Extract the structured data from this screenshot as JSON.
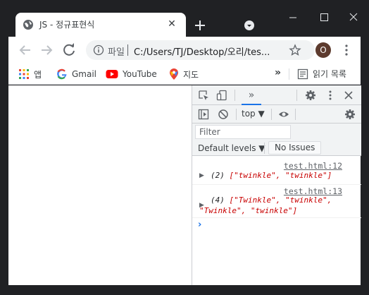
{
  "tab": {
    "title": "JS - 정규표현식",
    "close_glyph": "✕"
  },
  "toolbar": {
    "scheme_label": "파일",
    "url": "C:/Users/TJ/Desktop/오리/tes...",
    "avatar_letter": "O"
  },
  "bookmarks": {
    "items": [
      {
        "label": "앱",
        "icon": "apps-grid-icon"
      },
      {
        "label": "Gmail",
        "icon": "google-g-icon"
      },
      {
        "label": "YouTube",
        "icon": "youtube-icon"
      },
      {
        "label": "지도",
        "icon": "maps-pin-icon"
      }
    ],
    "more_glyph": "»",
    "reading_list_label": "읽기 목록"
  },
  "devtools": {
    "more_tabs_glyph": "»",
    "context": "top ▼",
    "filter_placeholder": "Filter",
    "levels_label": "Default levels ▼",
    "issues_label": "No Issues",
    "logs": [
      {
        "source": "test.html:12",
        "line1_count": "(2)",
        "line1_rest": "[\"twinkle\", \"twinkle\"]"
      },
      {
        "source": "test.html:13",
        "line1_count": "(4)",
        "line1_rest": "[\"Twinkle\", \"twinkle\",",
        "line2": "\"Twinkle\", \"twinkle\"]"
      }
    ],
    "prompt_glyph": "›"
  },
  "colors": {
    "accent": "#1a73e8",
    "string": "#c80000",
    "frame": "#202124"
  }
}
